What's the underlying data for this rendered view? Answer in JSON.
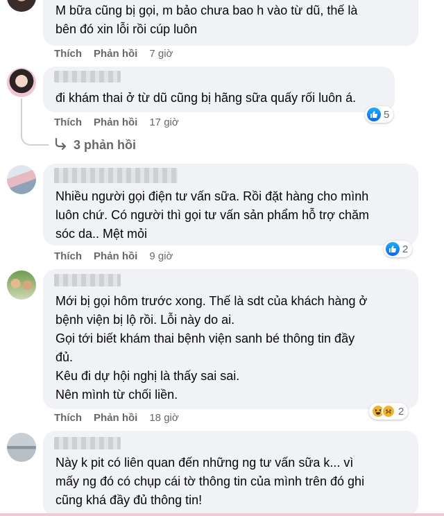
{
  "labels": {
    "like": "Thích",
    "reply": "Phản hồi"
  },
  "comments": [
    {
      "text": "M bữa cũng bị gọi, m bảo chưa bao h vào từ dũ, thế là\nbên đó xin lỗi rồi cúp luôn",
      "time": "7 giờ"
    },
    {
      "text": "đi khám thai ở từ dũ cũng bị hãng sữa quấy rối luôn á.",
      "time": "17 giờ",
      "reaction_count": "5"
    },
    {
      "text": "Nhiều người gọi điện tư vấn sữa. Rồi đặt hàng cho mình\nluôn chứ. Có người thì gọi tư vấn sản phẩm hỗ trợ chăm\nsóc da.. Mệt mỏi",
      "time": "9 giờ",
      "reaction_count": "2"
    },
    {
      "text": "Mới bị gọi hôm trước xong. Thế là sdt của khách hàng ở\nbệnh viện bị lộ rồi. Lỗi này do ai.\nGọi tới biết khám thai bệnh viện sanh bé thông tin đầy\nđủ.\nKêu đi dự hội nghị là thấy sai sai.\nNên mình từ chối liền.",
      "time": "18 giờ",
      "reaction_count": "2"
    },
    {
      "text": "Này k pit có liên quan đến những ng tư vấn sữa k... vì\nmấy ng đó có chụp cái tờ thông tin của mình trên đó ghi\ncũng khá đầy đủ thông tin!"
    }
  ],
  "view_replies": "3 phản hồi",
  "colors": {
    "bubble": "#f0f2f5",
    "meta": "#65676b",
    "like_blue": "#0866ff",
    "haha_yellow": "#f7b125"
  },
  "icons": {
    "like": "thumbs-up-icon",
    "haha": "laughing-face-icon",
    "sad": "crying-face-icon",
    "reply_arrow": "reply-arrow-icon"
  }
}
